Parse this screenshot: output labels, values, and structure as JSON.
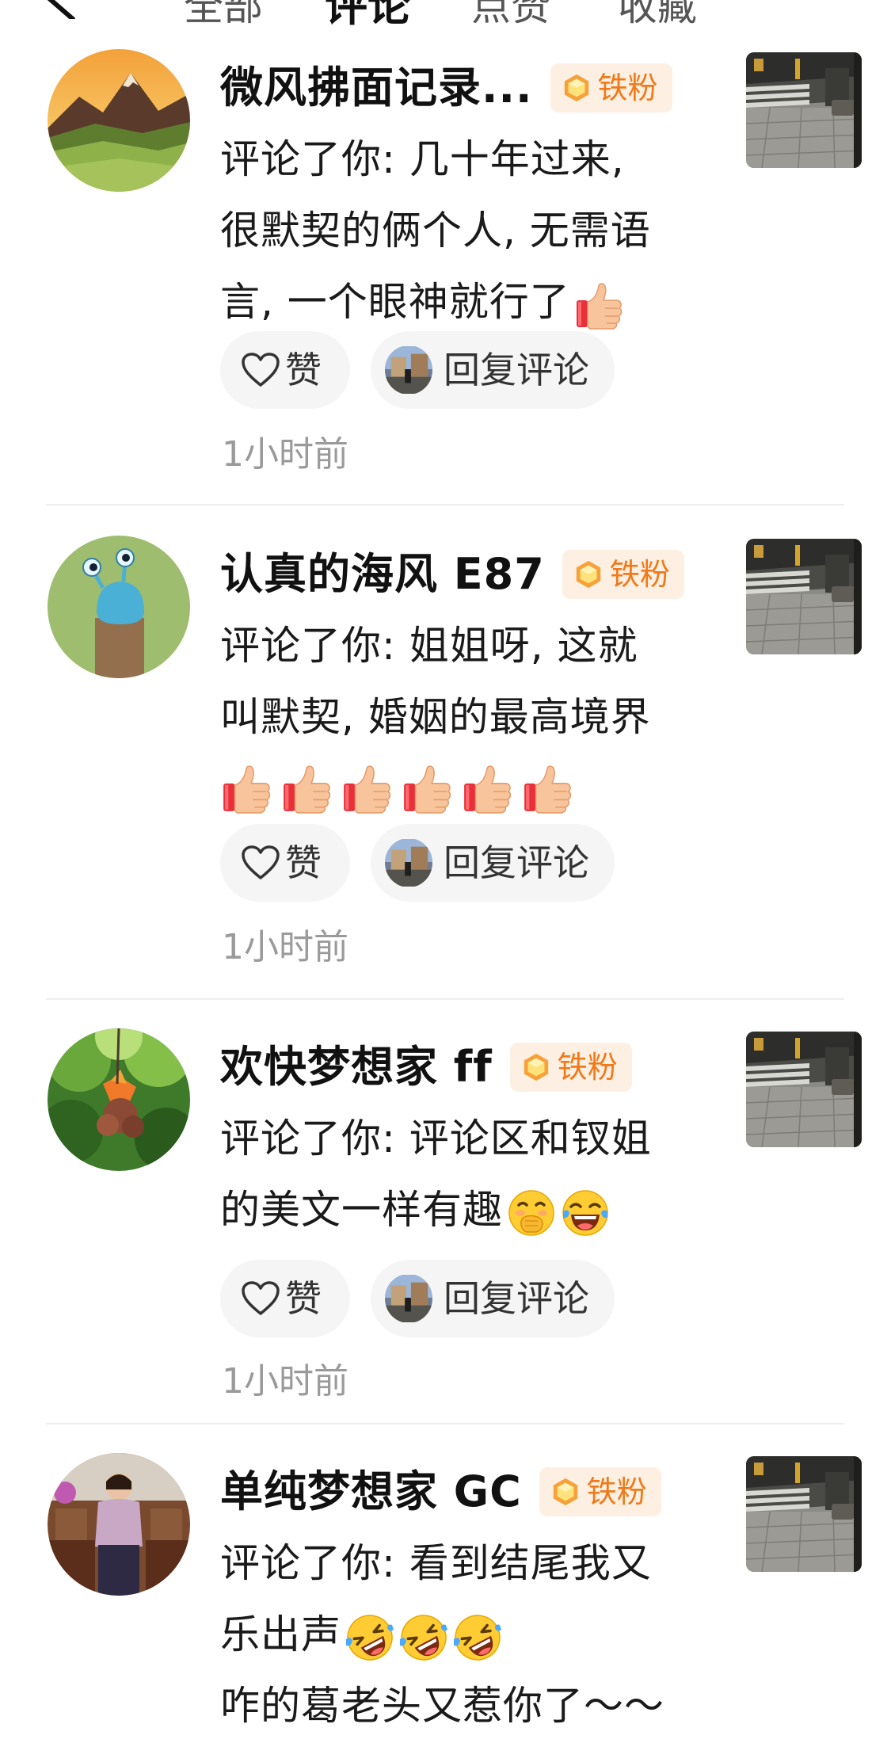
{
  "header": {
    "tabs": [
      {
        "label": "全部",
        "active": false
      },
      {
        "label": "评论",
        "active": true
      },
      {
        "label": "点赞",
        "active": false
      },
      {
        "label": "收藏",
        "active": false
      }
    ],
    "back_icon": "chevron-left-icon"
  },
  "badge_label": "铁粉",
  "actions": {
    "like_label": "赞",
    "reply_label": "回复评论"
  },
  "colors": {
    "badge_bg": "#fdf0e3",
    "badge_text": "#f07a1a",
    "pill_bg": "#f5f5f5",
    "time_text": "#9a9a9a"
  },
  "notifications": [
    {
      "username": "微风拂面记录...",
      "comment_lines": [
        "评论了你: 几十年过来,",
        "很默契的俩个人, 无需语",
        "言, 一个眼神就行了"
      ],
      "emojis": [
        "thumbs-up"
      ],
      "time": "1小时前"
    },
    {
      "username": "认真的海风 E87",
      "comment_lines": [
        "评论了你: 姐姐呀, 这就",
        "叫默契, 婚姻的最高境界"
      ],
      "emojis": [
        "thumbs-up",
        "thumbs-up",
        "thumbs-up",
        "thumbs-up",
        "thumbs-up",
        "thumbs-up"
      ],
      "time": "1小时前"
    },
    {
      "username": "欢快梦想家 ff",
      "comment_lines": [
        "评论了你: 评论区和钗姐",
        "的美文一样有趣"
      ],
      "emojis": [
        "hand-over-mouth",
        "tears-of-joy"
      ],
      "time": "1小时前"
    },
    {
      "username": "单纯梦想家 GC",
      "comment_lines": [
        "评论了你: 看到结尾我又",
        "乐出声",
        "咋的葛老头又惹你了～～"
      ],
      "emojis": [
        "rolling-laughing",
        "rolling-laughing",
        "rolling-laughing"
      ]
    }
  ]
}
